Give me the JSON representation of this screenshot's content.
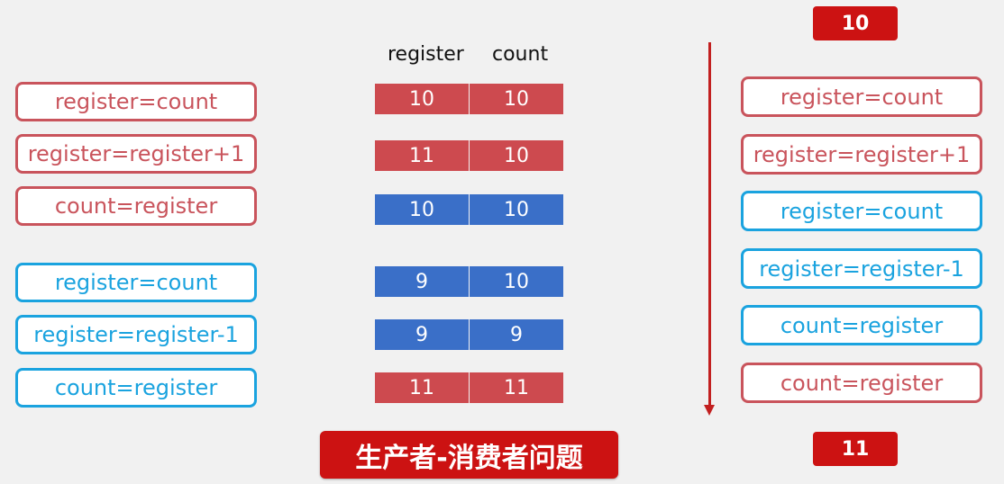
{
  "left_boxes": [
    {
      "text": "register=count",
      "color": "red"
    },
    {
      "text": "register=register+1",
      "color": "red"
    },
    {
      "text": "count=register",
      "color": "red"
    },
    {
      "text": "register=count",
      "color": "blue"
    },
    {
      "text": "register=register-1",
      "color": "blue"
    },
    {
      "text": "count=register",
      "color": "blue"
    }
  ],
  "table": {
    "headers": [
      "register",
      "count"
    ],
    "rows": [
      {
        "register": "10",
        "count": "10",
        "color": "red"
      },
      {
        "register": "11",
        "count": "10",
        "color": "red"
      },
      {
        "register": "10",
        "count": "10",
        "color": "blue"
      },
      {
        "register": "9",
        "count": "10",
        "color": "blue"
      },
      {
        "register": "9",
        "count": "9",
        "color": "blue"
      },
      {
        "register": "11",
        "count": "11",
        "color": "red"
      }
    ]
  },
  "right_boxes": [
    {
      "text": "register=count",
      "color": "red"
    },
    {
      "text": "register=register+1",
      "color": "red"
    },
    {
      "text": "register=count",
      "color": "blue"
    },
    {
      "text": "register=register-1",
      "color": "blue"
    },
    {
      "text": "count=register",
      "color": "blue"
    },
    {
      "text": "count=register",
      "color": "red"
    }
  ],
  "top_value": "10",
  "bottom_value": "11",
  "banner": "生产者-消费者问题",
  "colors": {
    "red": "#c9545c",
    "blue": "#1aa3df",
    "cell_red": "#cd4a4f",
    "cell_blue": "#3a6fc8",
    "badge": "#cc1212"
  }
}
